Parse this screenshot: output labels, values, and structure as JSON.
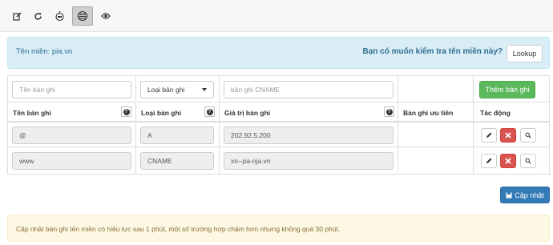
{
  "toolbar": {
    "buttons": [
      {
        "icon": "edit-icon",
        "active": false
      },
      {
        "icon": "refresh-icon",
        "active": false
      },
      {
        "icon": "robot-icon",
        "active": false
      },
      {
        "icon": "globe-icon",
        "active": true
      },
      {
        "icon": "eye-icon",
        "active": false
      }
    ]
  },
  "domain_bar": {
    "domain_text": "Tên miền: pia.vn",
    "question": "Bạn có muốn kiểm tra tên miền này?",
    "lookup_label": "Lookup"
  },
  "new_record": {
    "name_placeholder": "Tên bản ghi",
    "type_selected": "Loại bản ghi",
    "value_placeholder": "bản ghi CNAME",
    "add_label": "Thêm bản ghi"
  },
  "columns": {
    "name": "Tên bản ghi",
    "type": "Loại bản ghi",
    "value": "Giá trị bản ghi",
    "priority": "Bản ghi ưu tiên",
    "actions": "Tác động"
  },
  "records": [
    {
      "name": "@",
      "type": "A",
      "value": "202.92.5.200",
      "priority": ""
    },
    {
      "name": "www",
      "type": "CNAME",
      "value": "xn--pa-nja.vn",
      "priority": ""
    }
  ],
  "save_label": "Cập nhật",
  "notice": "Cập nhật bản ghi tên miền có hiệu lực sau 1 phút, một số trường hợp chậm hơn nhưng không quá 30 phút.",
  "colors": {
    "add_button": "#5cb85c",
    "delete_button": "#d9534f",
    "save_button": "#337ab7",
    "info_background": "#d9edf7",
    "notice_background": "#fcf8e3"
  }
}
